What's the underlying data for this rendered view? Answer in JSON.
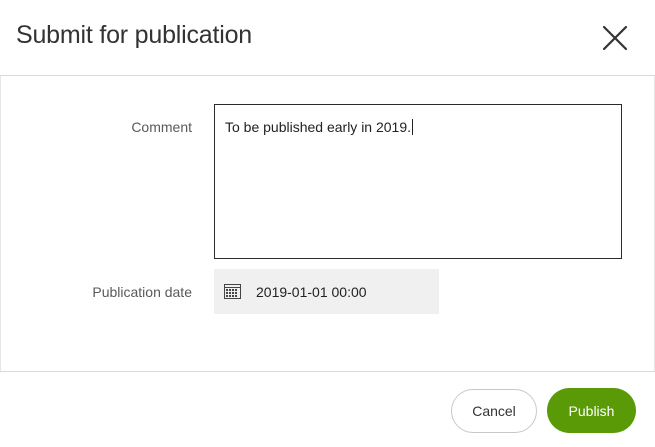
{
  "dialog": {
    "title": "Submit for publication",
    "close_icon": "close-icon"
  },
  "form": {
    "comment_label": "Comment",
    "comment_value": "To be published early in 2019.",
    "publication_date_label": "Publication date",
    "publication_date_value": "2019-01-01 00:00",
    "calendar_icon": "calendar-icon"
  },
  "footer": {
    "cancel_label": "Cancel",
    "publish_label": "Publish"
  },
  "colors": {
    "publish_button": "#5a9a07",
    "comment_border": "#2b2b2b",
    "date_field_bg": "#f0f0f0"
  }
}
